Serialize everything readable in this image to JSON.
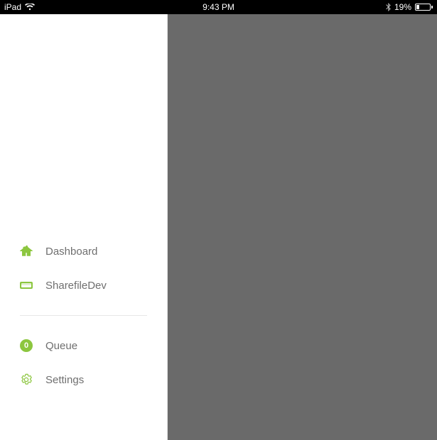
{
  "status_bar": {
    "device": "iPad",
    "time": "9:43 PM",
    "battery_percent": "19%"
  },
  "sidebar": {
    "group1": [
      {
        "label": "Dashboard"
      },
      {
        "label": "SharefileDev"
      }
    ],
    "group2": [
      {
        "label": "Queue",
        "badge": "0"
      },
      {
        "label": "Settings"
      }
    ]
  }
}
